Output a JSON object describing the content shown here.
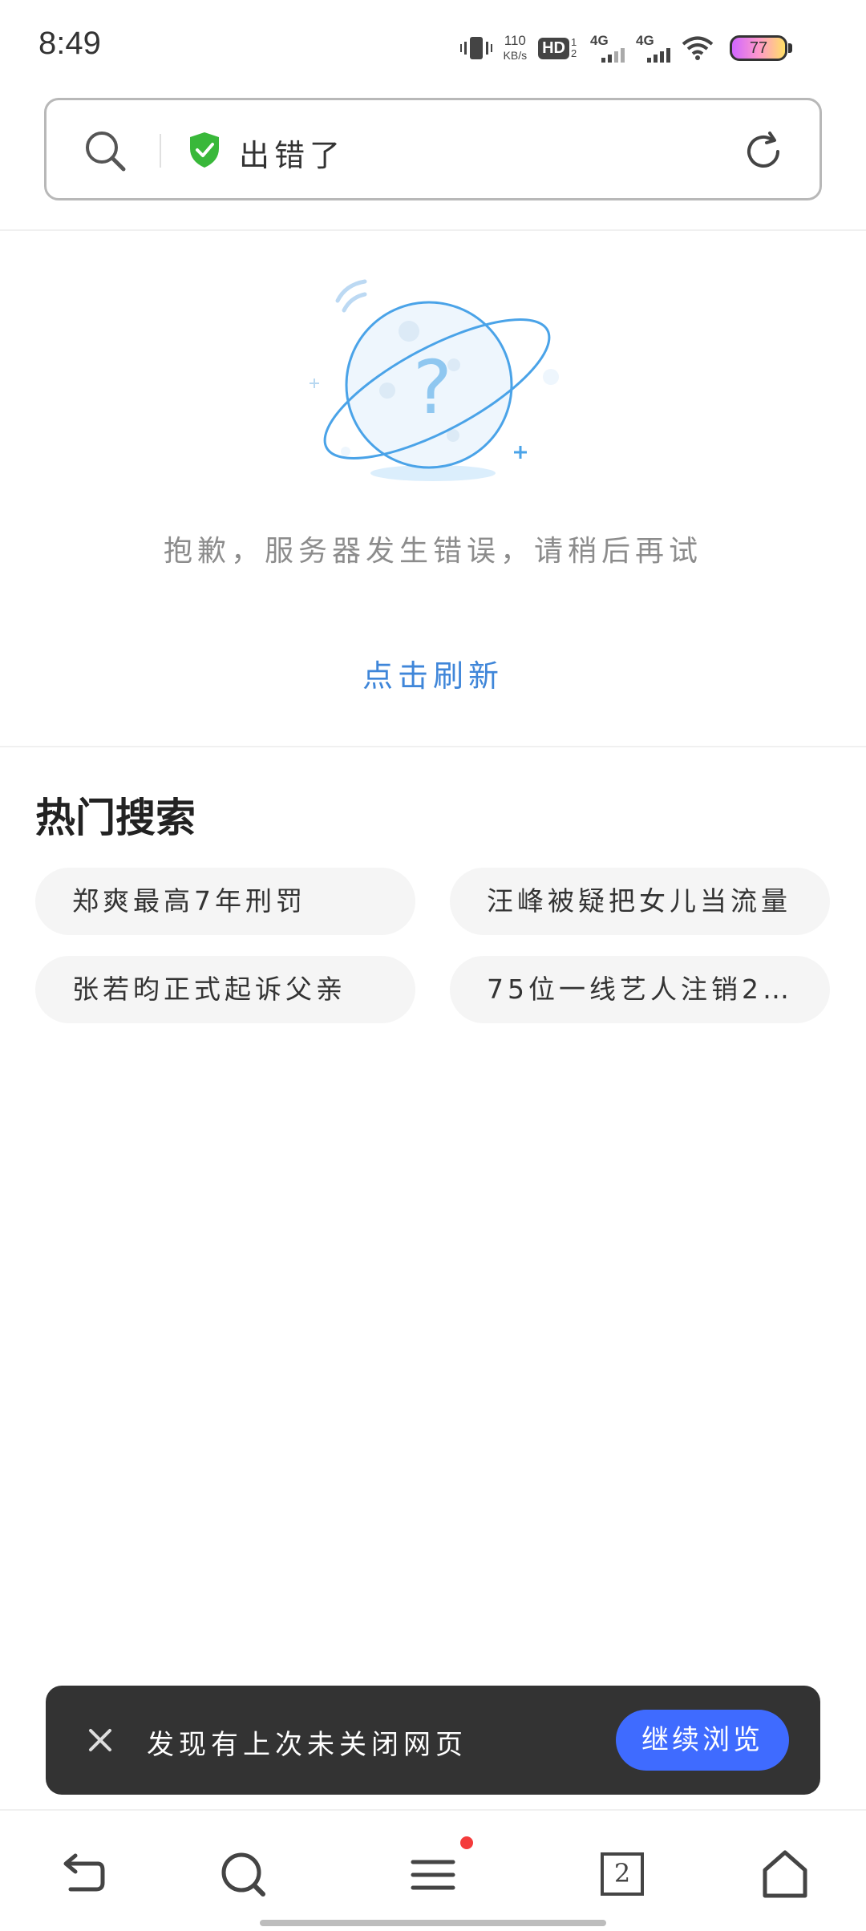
{
  "status_bar": {
    "time": "8:49",
    "net_speed_value": "110",
    "net_speed_unit": "KB/s",
    "hd_label": "HD",
    "hd_sub": "1 2",
    "sim1_label": "4G",
    "sim2_label": "4G",
    "battery_level": "77",
    "icons": [
      "vibrate-icon",
      "hd-voice-icon",
      "signal-icon",
      "signal-icon",
      "wifi-icon",
      "battery-icon"
    ]
  },
  "address_bar": {
    "text": "出错了",
    "icons": [
      "search-icon",
      "shield-check-icon",
      "reload-icon"
    ],
    "shield_color": "#39b83a"
  },
  "error": {
    "message": "抱歉，服务器发生错误，请稍后再试",
    "refresh_label": "点击刷新"
  },
  "hot_search": {
    "title": "热门搜索",
    "items": [
      "郑爽最高7年刑罚",
      "汪峰被疑把女儿当流量",
      "张若昀正式起诉父亲",
      "75位一线艺人注销2…"
    ]
  },
  "snackbar": {
    "message": "发现有上次未关闭网页",
    "action_label": "继续浏览",
    "action_color": "#3f6bff"
  },
  "bottom_nav": {
    "tab_count": "2",
    "icons": [
      "back-icon",
      "search-icon",
      "menu-icon",
      "tabs-icon",
      "home-icon"
    ]
  }
}
